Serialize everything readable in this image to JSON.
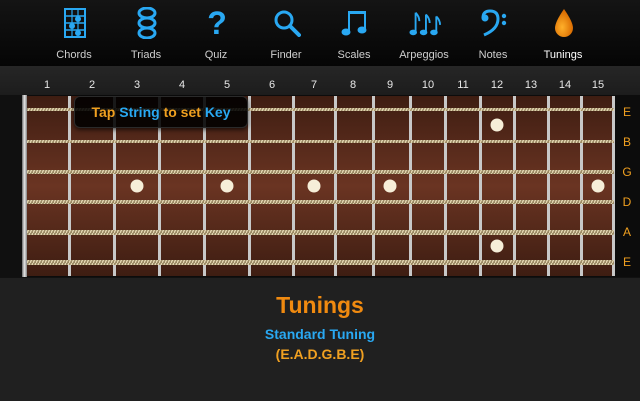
{
  "toolbar": {
    "items": [
      {
        "label": "Chords",
        "icon": "chord-diagram-icon"
      },
      {
        "label": "Triads",
        "icon": "triad-stack-icon"
      },
      {
        "label": "Quiz",
        "icon": "question-mark-icon"
      },
      {
        "label": "Finder",
        "icon": "magnifier-icon"
      },
      {
        "label": "Scales",
        "icon": "beamed-notes-icon"
      },
      {
        "label": "Arpeggios",
        "icon": "triple-notes-icon"
      },
      {
        "label": "Notes",
        "icon": "bass-clef-icon"
      },
      {
        "label": "Tunings",
        "icon": "tuning-drop-icon"
      }
    ],
    "active": "Tunings"
  },
  "fret_numbers": [
    "1",
    "2",
    "3",
    "4",
    "5",
    "6",
    "7",
    "8",
    "9",
    "10",
    "11",
    "12",
    "13",
    "14",
    "15"
  ],
  "strings": [
    "E",
    "B",
    "G",
    "D",
    "A",
    "E"
  ],
  "hint": {
    "part1": "Tap",
    "part2": "String",
    "part3": "to set",
    "part4": "Key"
  },
  "inlays": {
    "single_frets": [
      3,
      5,
      7,
      9,
      15
    ],
    "double_fret": 12
  },
  "panel": {
    "title": "Tunings",
    "tuning_name": "Standard Tuning",
    "tuning_notes": "(E.A.D.G.B.E)"
  },
  "colors": {
    "accent_orange": "#f0a020",
    "accent_blue": "#29a8f2",
    "wood": "#5a2c1c"
  }
}
